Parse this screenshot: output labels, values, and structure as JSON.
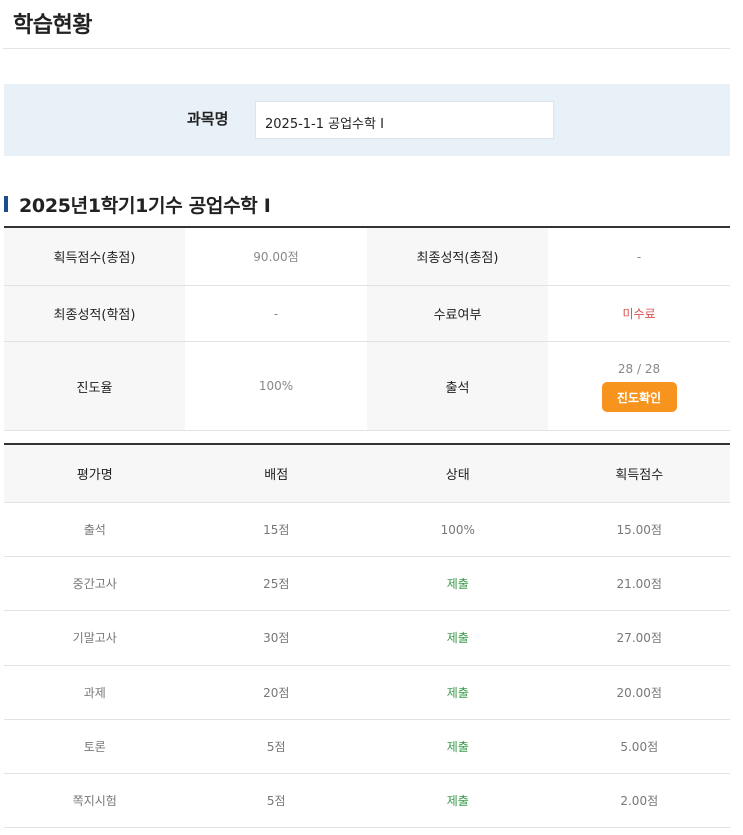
{
  "page": {
    "title": "학습현황"
  },
  "filter": {
    "label": "과목명",
    "selected": "2025-1-1 공업수학 I"
  },
  "course": {
    "title": "2025년1학기1기수 공업수학 I"
  },
  "summary": {
    "rows": [
      {
        "label1": "획득점수(총점)",
        "value1": "90.00점",
        "label2": "최종성적(총점)",
        "value2": "-"
      },
      {
        "label1": "최종성적(학점)",
        "value1": "-",
        "label2": "수료여부",
        "value2": "미수료"
      },
      {
        "label1": "진도율",
        "value1": "100%",
        "label2": "출석",
        "value2": "28 / 28"
      }
    ],
    "progress_button": "진도확인"
  },
  "grades": {
    "headers": [
      "평가명",
      "배점",
      "상태",
      "획득점수"
    ],
    "rows": [
      {
        "name": "출석",
        "points": "15점",
        "status": "100%",
        "score": "15.00점"
      },
      {
        "name": "중간고사",
        "points": "25점",
        "status": "제출",
        "score": "21.00점"
      },
      {
        "name": "기말고사",
        "points": "30점",
        "status": "제출",
        "score": "27.00점"
      },
      {
        "name": "과제",
        "points": "20점",
        "status": "제출",
        "score": "20.00점"
      },
      {
        "name": "토론",
        "points": "5점",
        "status": "제출",
        "score": "5.00점"
      },
      {
        "name": "쪽지시험",
        "points": "5점",
        "status": "제출",
        "score": "2.00점"
      }
    ]
  },
  "colors": {
    "accent_bar": "#1a4f8c",
    "filter_bg": "#e8f0f8",
    "button": "#f7941d",
    "incomplete_text": "#d9534f",
    "submitted_text": "#3a9a4a"
  }
}
